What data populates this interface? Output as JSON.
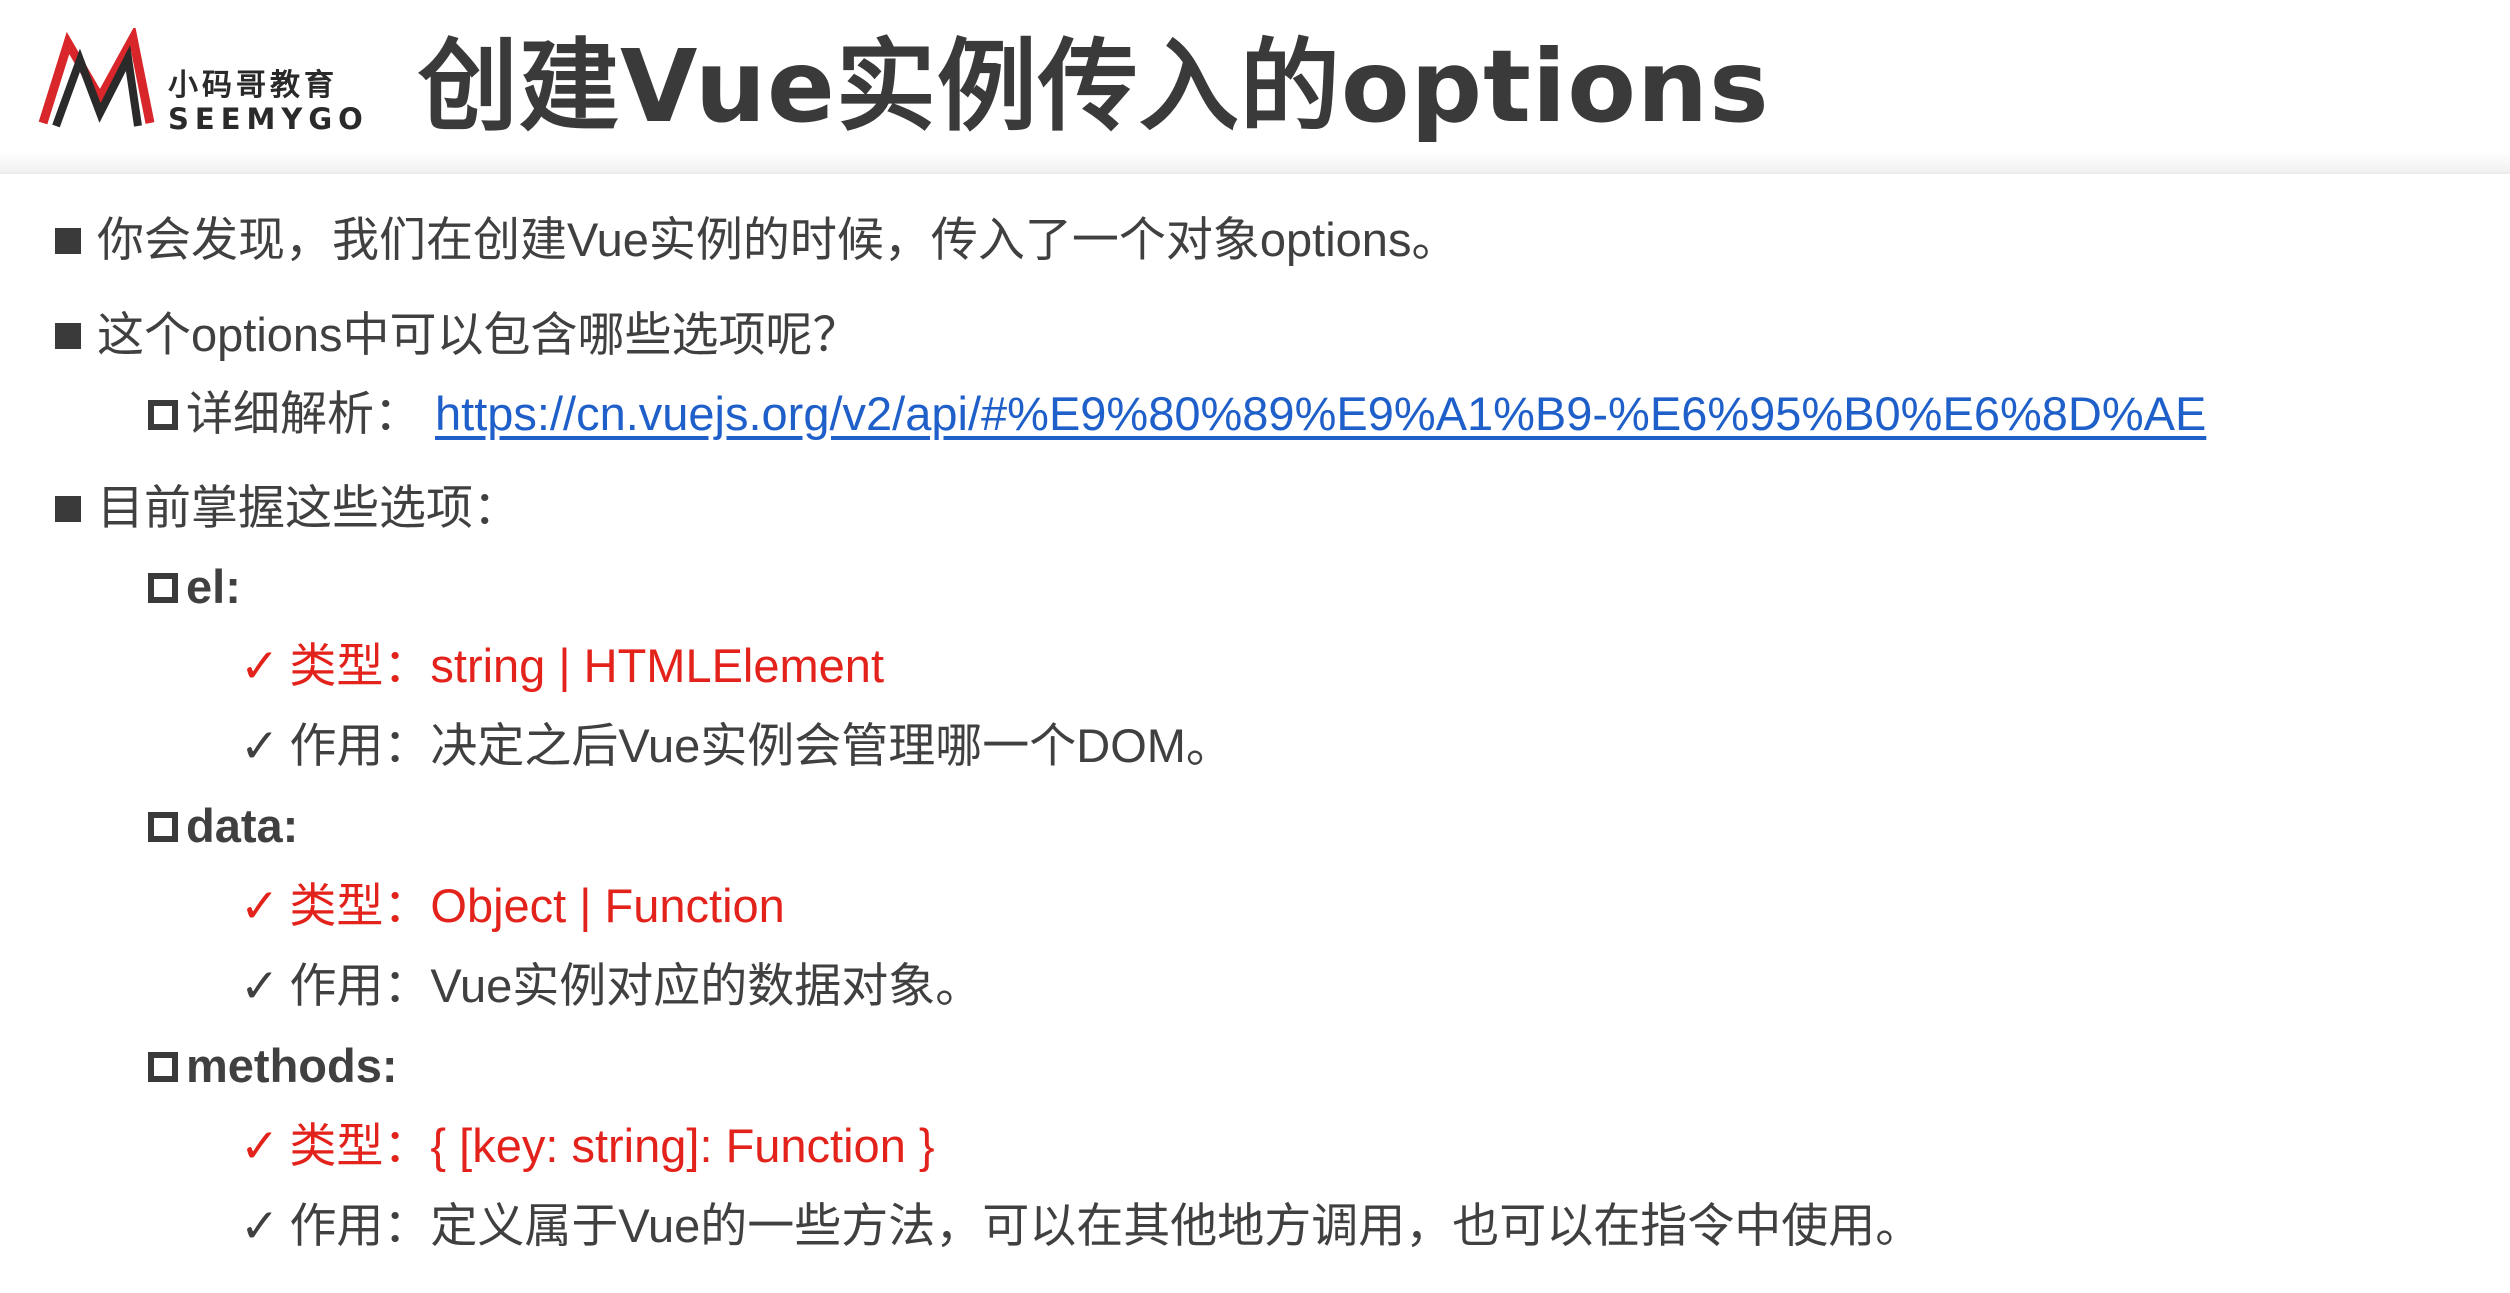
{
  "header": {
    "logo_cn": "小码哥教育",
    "logo_en": "SEEMYGO",
    "title": "创建Vue实例传入的options"
  },
  "bullets": {
    "b1": "你会发现，我们在创建Vue实例的时候，传入了一个对象options。",
    "b2": "这个options中可以包含哪些选项呢？",
    "detail_label": "详细解析：",
    "detail_link": "https://cn.vuejs.org/v2/api/#%E9%80%89%E9%A1%B9-%E6%95%B0%E6%8D%AE",
    "b3": "目前掌握这些选项："
  },
  "options": {
    "el": {
      "name": "el:",
      "type": "类型：string | HTMLElement",
      "usage": "作用：决定之后Vue实例会管理哪一个DOM。"
    },
    "data": {
      "name": "data:",
      "type": "类型：Object | Function",
      "usage": "作用：Vue实例对应的数据对象。"
    },
    "methods": {
      "name": "methods:",
      "type": "类型：{ [key: string]: Function }",
      "usage": "作用：定义属于Vue的一些方法，可以在其他地方调用，也可以在指令中使用。"
    }
  },
  "symbols": {
    "check": "✓"
  },
  "colors": {
    "accent_red": "#e3231b",
    "link_blue": "#1f5fc9",
    "text": "#404040"
  },
  "icons": {
    "logo": "seemygo-m-logo",
    "level1": "filled-square-bullet",
    "level2": "hollow-square-bullet",
    "level3": "check-icon"
  }
}
